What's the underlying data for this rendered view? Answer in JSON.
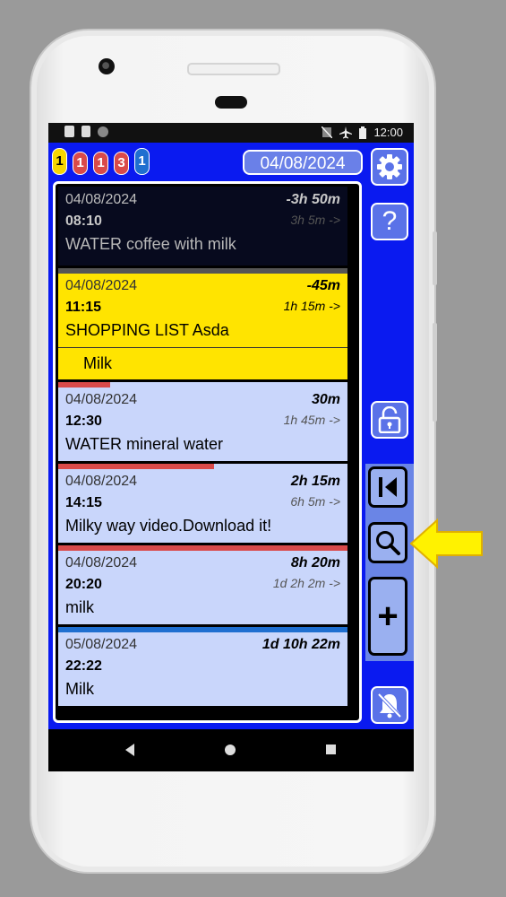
{
  "status_bar": {
    "time": "12:00"
  },
  "header": {
    "badges": [
      {
        "value": "1",
        "color": "#f7d600",
        "text_color": "#000"
      },
      {
        "value": "1",
        "color": "#d94a4a",
        "text_color": "#fff"
      },
      {
        "value": "1",
        "color": "#d94a4a",
        "text_color": "#fff"
      },
      {
        "value": "3",
        "color": "#d94a4a",
        "text_color": "#fff"
      },
      {
        "value": "1",
        "color": "#1f6fd0",
        "text_color": "#fff"
      }
    ],
    "date": "04/08/2024"
  },
  "items": [
    {
      "date": "04/08/2024",
      "rel": "-3h 50m",
      "time": "08:10",
      "sub": "3h 5m ->",
      "title": "WATER coffee with milk",
      "theme": "dark",
      "bar_color": "#555555",
      "bar_level": 1.0
    },
    {
      "date": "04/08/2024",
      "rel": "-45m",
      "time": "11:15",
      "sub": "1h 15m ->",
      "title": "SHOPPING LIST Asda",
      "theme": "yellow",
      "note": "Milk",
      "bar_color": "#d94a4a",
      "bar_level": 0.18
    },
    {
      "date": "04/08/2024",
      "rel": "30m",
      "time": "12:30",
      "sub": "1h 45m ->",
      "title": "WATER mineral water",
      "theme": "light",
      "bar_color": "#d94a4a",
      "bar_level": 0.54
    },
    {
      "date": "04/08/2024",
      "rel": "2h 15m",
      "time": "14:15",
      "sub": "6h 5m ->",
      "title": "Milky way video.Download it!",
      "theme": "light",
      "bar_color": "#d94a4a",
      "bar_level": 1.0
    },
    {
      "date": "04/08/2024",
      "rel": "8h 20m",
      "time": "20:20",
      "sub": "1d 2h 2m ->",
      "title": "milk",
      "theme": "light",
      "bar_color": "#1f6fd0",
      "bar_level": 1.0
    },
    {
      "date": "05/08/2024",
      "rel": "1d 10h 22m",
      "time": "22:22",
      "sub": "",
      "title": "Milk",
      "theme": "light"
    }
  ],
  "icons": {
    "settings": "gear-icon",
    "help": "question-icon",
    "lock": "unlock-icon",
    "first": "skip-to-start-icon",
    "search": "magnifier-icon",
    "add": "plus-icon",
    "bell": "bell-off-icon"
  },
  "help_label": "?",
  "add_label": "+"
}
